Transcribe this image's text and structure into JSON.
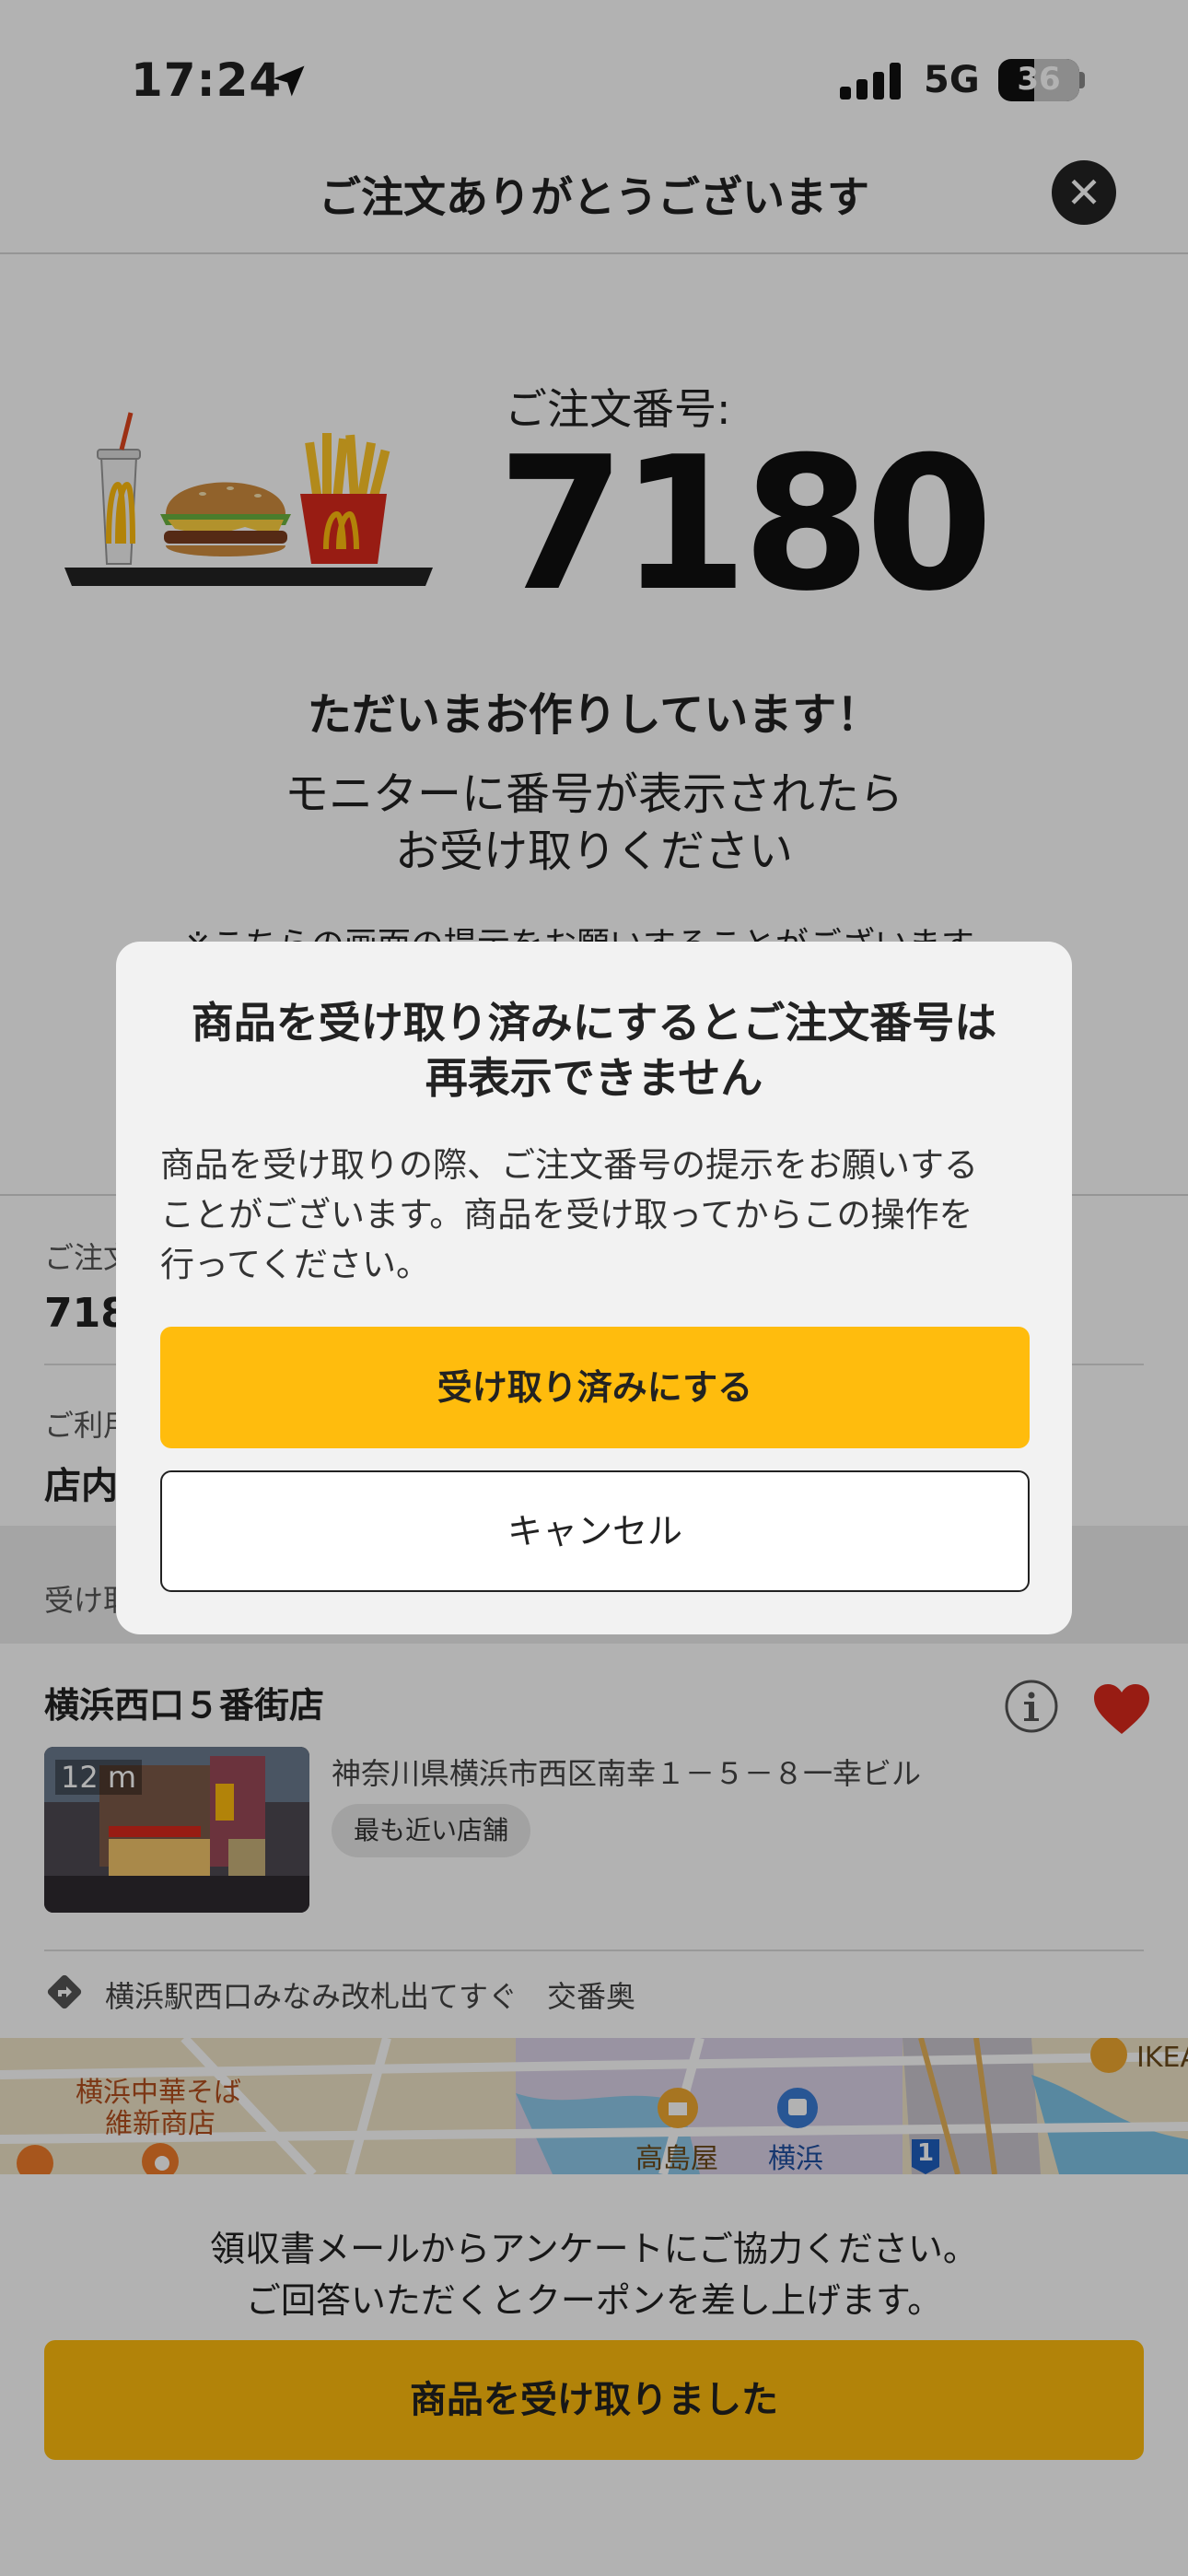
{
  "status_bar": {
    "time": "17:24",
    "network": "5G",
    "battery": "36"
  },
  "header": {
    "title": "ご注文ありがとうございます",
    "close_symbol": "✕"
  },
  "order": {
    "label": "ご注文番号:",
    "number": "7180",
    "preparing": "ただいまお作りしています！",
    "monitor_line1": "モニターに番号が表示されたら",
    "monitor_line2": "お受け取りください",
    "notice": "※こちらの画面の提示をお願いすることがございます。"
  },
  "details": {
    "row1_label": "ご注文",
    "row1_value": "718",
    "row2_label": "ご利用",
    "row2_value": "店内",
    "row3_label": "受け取"
  },
  "store": {
    "name": "横浜西口５番街店",
    "distance": "12 m",
    "address": "神奈川県横浜市西区南幸１－５－８一幸ビル",
    "nearest_badge": "最も近い店舗",
    "directions": "横浜駅西口みなみ改札出てすぐ　交番奥"
  },
  "map": {
    "labels": [
      "横浜中華そば",
      "維新商店",
      "高島屋",
      "横浜",
      "1",
      "IKEA"
    ]
  },
  "bottom": {
    "survey_line1": "領収書メールからアンケートにご協力ください。",
    "survey_line2": "ご回答いただくとクーポンを差し上げます。",
    "received_button": "商品を受け取りました"
  },
  "modal": {
    "title_line1": "商品を受け取り済みにするとご注文番号は",
    "title_line2": "再表示できません",
    "body_line1": "商品を受け取りの際、ご注文番号の提示をお願いする",
    "body_line2": "ことがございます。商品を受け取ってからこの操作を",
    "body_line3": "行ってください。",
    "confirm_button": "受け取り済みにする",
    "cancel_button": "キャンセル"
  },
  "colors": {
    "brand_yellow": "#ffbc0d",
    "brand_red": "#da291c",
    "dark": "#232323"
  }
}
